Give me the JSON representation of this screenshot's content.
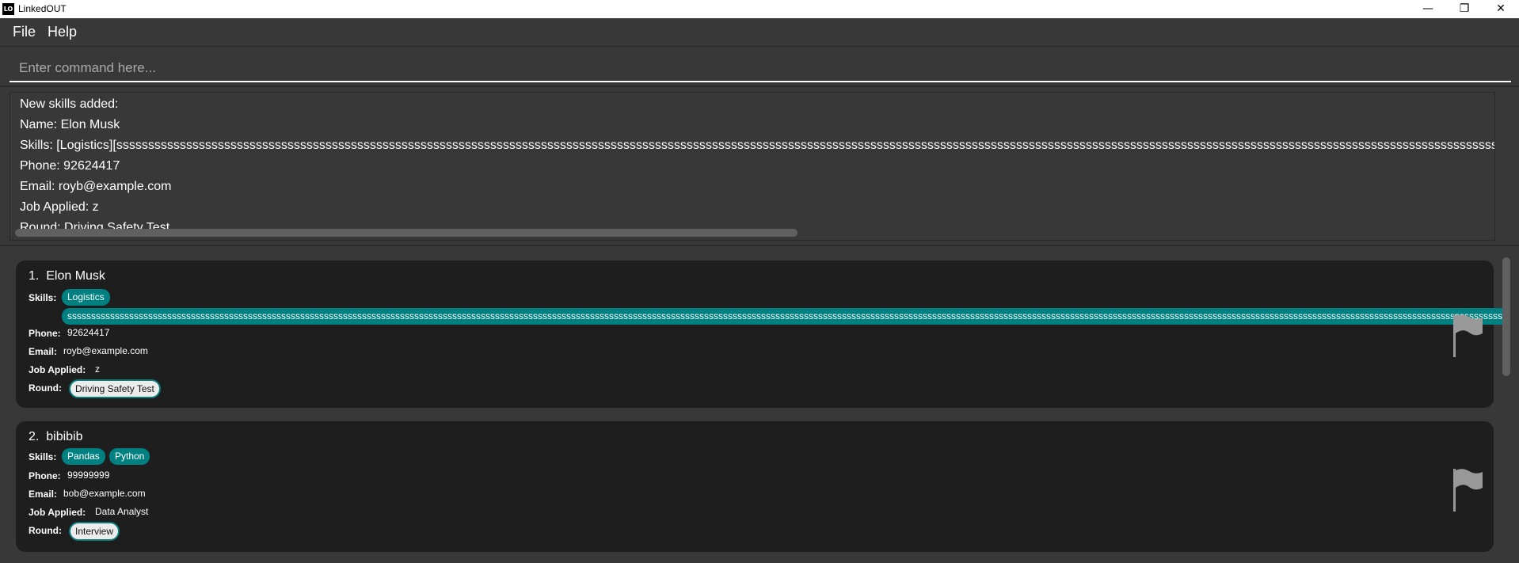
{
  "window": {
    "title": "LinkedOUT",
    "logo_text": "LO",
    "minimize": "—",
    "restore": "❐",
    "close": "✕"
  },
  "menu": {
    "file": "File",
    "help": "Help"
  },
  "command": {
    "placeholder": "Enter command here...",
    "value": ""
  },
  "result": {
    "lines": [
      "New skills added:",
      "Name: Elon Musk",
      "Skills: [Logistics][sssssssssssssssssssssssssssssssssssssssssssssssssssssssssssssssssssssssssssssssssssssssssssssssssssssssssssssssssssssssssssssssssssssssssssssssssssssssssssssssssssssssssssssssssssssssssssssssssssssssssssssssssssssssssssssssssssssssssssssssssssssssssssssssssssssssssssssssssssssssssssssssssssssssssssssss",
      "Phone: 92624417",
      "Email: royb@example.com",
      "Job Applied: z",
      "Round: Driving Safety Test"
    ]
  },
  "labels": {
    "skills": "Skills:",
    "phone": "Phone:",
    "email": "Email:",
    "job": "Job Applied:",
    "round": "Round:"
  },
  "applicants": [
    {
      "index": "1.",
      "name": "Elon Musk",
      "skills": [
        "Logistics",
        "sssssssssssssssssssssssssssssssssssssssssssssssssssssssssssssssssssssssssssssssssssssssssssssssssssssssssssssssssssssssssssssssssssssssssssssssssssssssssssssssssssssssssssssssssssssssssssssssssssssssssssssssssssssssssssssssssssssssssssssssssssssssssssssssssssssssssssssssssssssssssssssssssssssssssssssssssssssssss"
      ],
      "phone": "92624417",
      "email": "royb@example.com",
      "job": "z",
      "round": "Driving Safety Test"
    },
    {
      "index": "2.",
      "name": "bibibib",
      "skills": [
        "Pandas",
        "Python"
      ],
      "phone": "99999999",
      "email": "bob@example.com",
      "job": "Data Analyst",
      "round": "Interview"
    }
  ],
  "colors": {
    "accent": "#008080",
    "background": "#383838",
    "card": "#1e1e1e"
  }
}
